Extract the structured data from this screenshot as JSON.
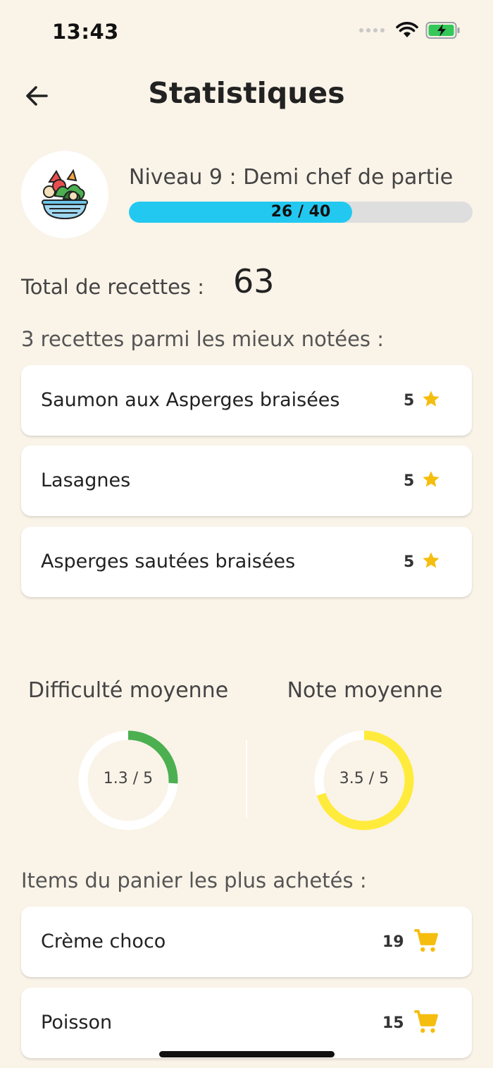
{
  "status_bar": {
    "time": "13:43"
  },
  "header": {
    "title": "Statistiques"
  },
  "level": {
    "text": "Niveau 9 : Demi chef de partie",
    "progress_label": "26 / 40",
    "progress_current": 26,
    "progress_max": 40,
    "color": "#22c8f0"
  },
  "total": {
    "label": "Total de recettes :",
    "value": "63"
  },
  "top_recipes": {
    "title": "3 recettes parmi les mieux notées :",
    "items": [
      {
        "name": "Saumon aux Asperges braisées",
        "rating": "5"
      },
      {
        "name": "Lasagnes",
        "rating": "5"
      },
      {
        "name": "Asperges sautées braisées",
        "rating": "5"
      }
    ],
    "icon": "star-icon",
    "icon_color": "#f5bd0e"
  },
  "gauges": {
    "difficulty": {
      "title": "Difficulté moyenne",
      "label": "1.3 / 5",
      "value": 1.3,
      "max": 5,
      "color": "#4caf50"
    },
    "rating": {
      "title": "Note moyenne",
      "label": "3.5 / 5",
      "value": 3.5,
      "max": 5,
      "color": "#ffeb3b"
    }
  },
  "cart": {
    "title": "Items du panier les plus achetés :",
    "items": [
      {
        "name": "Crème choco",
        "count": "19"
      },
      {
        "name": "Poisson",
        "count": "15"
      }
    ],
    "icon": "cart-icon",
    "icon_color": "#f5bd0e"
  }
}
